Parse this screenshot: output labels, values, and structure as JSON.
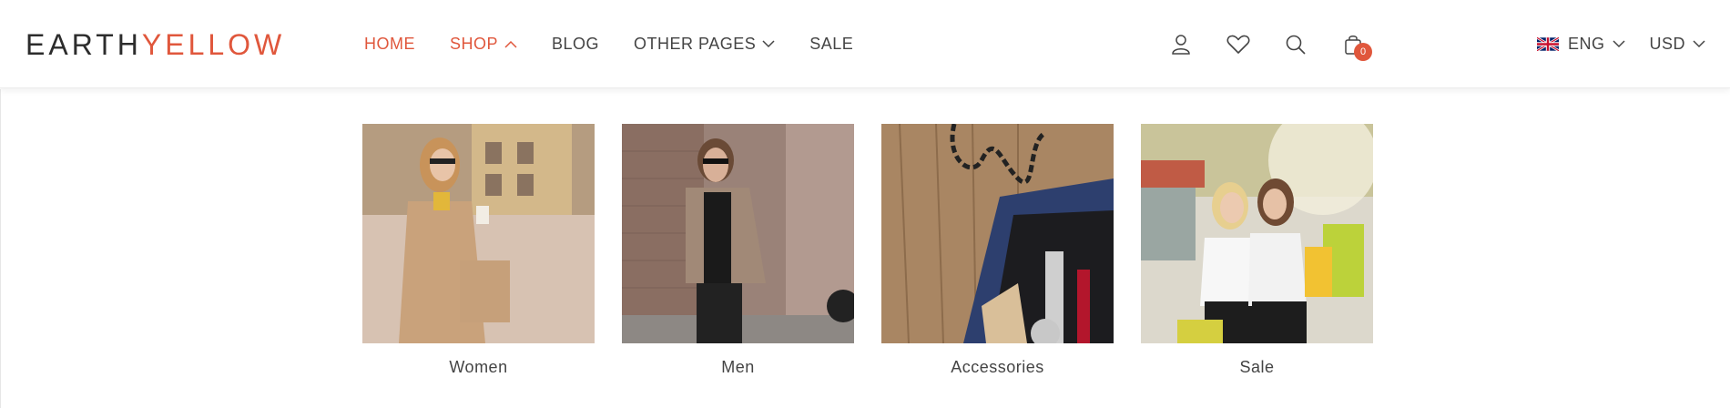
{
  "logo": {
    "part1": "EARTH",
    "part2": "YELLOW"
  },
  "nav": [
    {
      "label": "HOME"
    },
    {
      "label": "SHOP"
    },
    {
      "label": "BLOG"
    },
    {
      "label": "OTHER PAGES"
    },
    {
      "label": "SALE"
    }
  ],
  "cart": {
    "count": "0"
  },
  "locale": {
    "language": "ENG",
    "currency": "USD"
  },
  "categories": [
    {
      "label": "Women"
    },
    {
      "label": "Men"
    },
    {
      "label": "Accessories"
    },
    {
      "label": "Sale"
    }
  ],
  "colors": {
    "accent": "#e0573c",
    "text": "#444444"
  },
  "icons": [
    "user-icon",
    "heart-icon",
    "search-icon",
    "cart-icon",
    "uk-flag-icon",
    "chevron-down-icon",
    "chevron-up-icon"
  ]
}
